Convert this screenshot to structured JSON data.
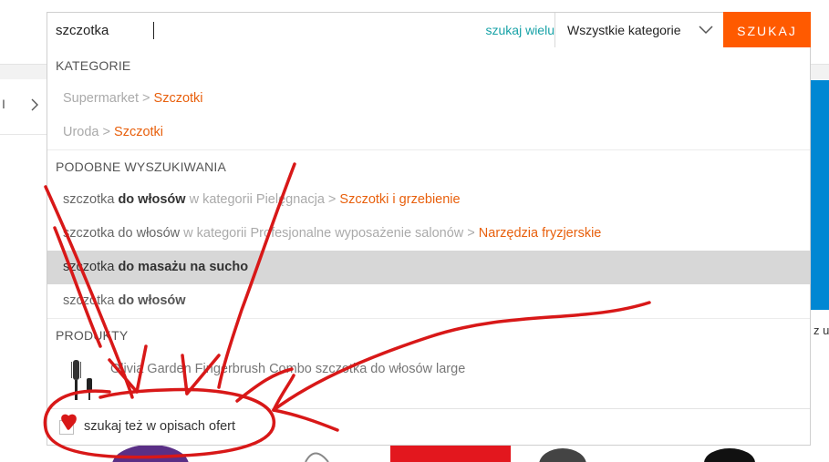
{
  "search": {
    "query": "szczotka",
    "search_many_label": "szukaj wielu",
    "category_label": "Wszystkie kategorie",
    "button_label": "SZUKAJ"
  },
  "background": {
    "left_fragment": "I",
    "right_fragment": "z u"
  },
  "dropdown": {
    "categories_header": "KATEGORIE",
    "categories": [
      {
        "parent": "Supermarket",
        "sep": " > ",
        "child": "Szczotki"
      },
      {
        "parent": "Uroda",
        "sep": " > ",
        "child": "Szczotki"
      }
    ],
    "similar_header": "PODOBNE WYSZUKIWANIA",
    "similar": [
      {
        "q": "szczotka ",
        "bold": "do włosów",
        "ctx": " w kategorii Pielęgnacja > ",
        "cat": "Szczotki i grzebienie"
      },
      {
        "q": "szczotka do włosów",
        "bold": "",
        "ctx": " w kategorii Profesjonalne wyposażenie salonów > ",
        "cat": "Narzędzia fryzjerskie"
      },
      {
        "q": "szczotka ",
        "bold": "do masażu na sucho",
        "ctx": "",
        "cat": ""
      },
      {
        "q": "szczotka ",
        "bold": "do włosów",
        "ctx": "",
        "cat": ""
      }
    ],
    "products_header": "PRODUKTY",
    "products": [
      {
        "name": "Olivia Garden Fingerbrush Combo szczotka do włosów large"
      }
    ],
    "footer_checkbox_label": "szukaj też w opisach ofert"
  },
  "colors": {
    "accent_orange": "#ff5a00",
    "link_orange": "#e8600d",
    "teal": "#17a2a7",
    "highlight_row": "#d7d7d7",
    "annotation_red": "#d81818",
    "banner_blue": "#0087d3"
  }
}
